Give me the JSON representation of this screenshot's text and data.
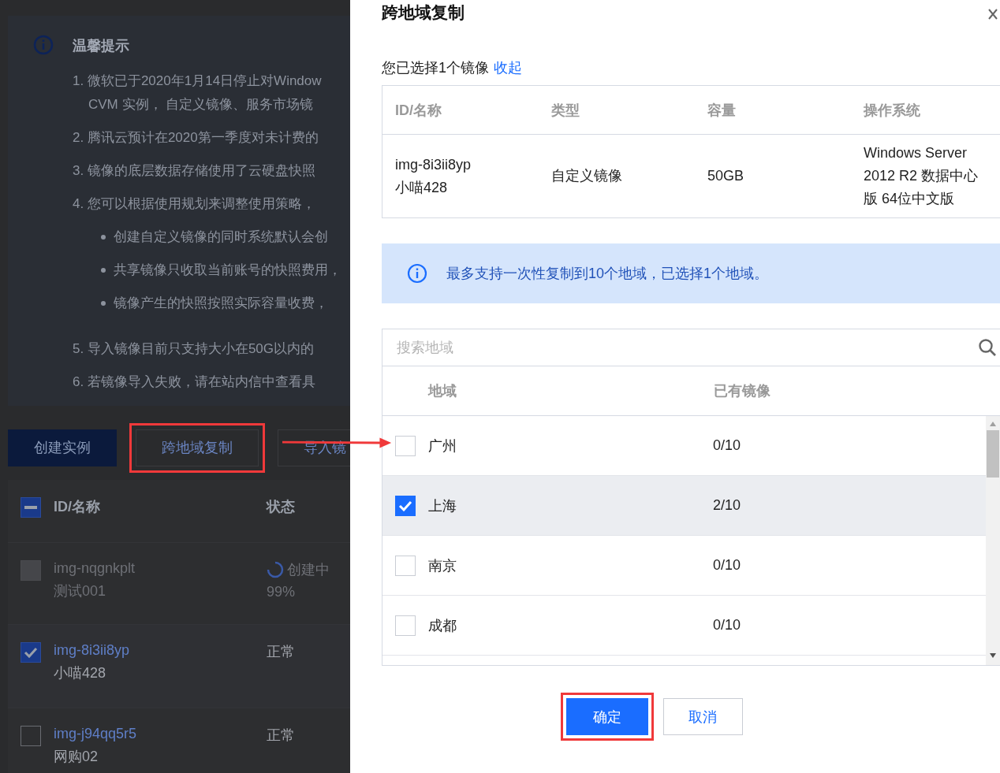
{
  "notice": {
    "title": "温馨提示",
    "items": [
      {
        "kind": "numbered",
        "lines": [
          "1. 微软已于2020年1月14日停止对Window",
          "CVM 实例， 自定义镜像、服务市场镜"
        ]
      },
      {
        "kind": "numbered",
        "lines": [
          "2. 腾讯云预计在2020第一季度对未计费的"
        ]
      },
      {
        "kind": "numbered",
        "lines": [
          "3. 镜像的底层数据存储使用了云硬盘快照"
        ]
      },
      {
        "kind": "numbered",
        "lines": [
          "4. 您可以根据使用规划来调整使用策略，"
        ]
      },
      {
        "kind": "bullet",
        "lines": [
          "创建自定义镜像的同时系统默认会创"
        ]
      },
      {
        "kind": "bullet",
        "lines": [
          "共享镜像只收取当前账号的快照费用，"
        ]
      },
      {
        "kind": "bullet",
        "lines": [
          "镜像产生的快照按照实际容量收费，"
        ]
      },
      {
        "kind": "numbered",
        "lines": [
          "5. 导入镜像目前只支持大小在50G以内的"
        ]
      },
      {
        "kind": "numbered",
        "lines": [
          "6. 若镜像导入失败，请在站内信中查看具"
        ]
      }
    ]
  },
  "toolbar": [
    {
      "label": "创建实例",
      "kind": "primary",
      "highlighted": false
    },
    {
      "label": "跨地域复制",
      "kind": "default",
      "highlighted": true
    },
    {
      "label": "导入镜",
      "kind": "default",
      "highlighted": false
    }
  ],
  "image_list": {
    "select_all_checked": true,
    "select_all_indeterminate": true,
    "columns": [
      "ID/名称",
      "状态"
    ],
    "rows": [
      {
        "id": "img-nqgnkplt",
        "name": "测试001",
        "status": "创建中",
        "progress": "99%",
        "kind": "creating",
        "checked": false,
        "disabled": true
      },
      {
        "id": "img-8i3ii8yp",
        "name": "小喵428",
        "status": "正常",
        "kind": "normal",
        "checked": true,
        "disabled": false
      },
      {
        "id": "img-j94qq5r5",
        "name": "网购02",
        "status": "正常",
        "kind": "normal",
        "checked": false,
        "disabled": false
      }
    ]
  },
  "drawer": {
    "title": "跨地域复制",
    "selected_note": "您已选择1个镜像",
    "collapse_link": "收起",
    "image_table": {
      "columns": [
        "ID/名称",
        "类型",
        "容量",
        "操作系统"
      ],
      "rows": [
        {
          "id": "img-8i3ii8yp",
          "name": "小喵428",
          "type": "自定义镜像",
          "size": "50GB",
          "os": "Windows Server 2012 R2 数据中心版 64位中文版"
        }
      ]
    },
    "info": "最多支持一次性复制到10个地域，已选择1个地域。",
    "search": {
      "placeholder": "搜索地域"
    },
    "region_table": {
      "columns": [
        "地域",
        "已有镜像"
      ],
      "rows": [
        {
          "region": "广州",
          "count": "0/10",
          "checked": false
        },
        {
          "region": "上海",
          "count": "2/10",
          "checked": true
        },
        {
          "region": "南京",
          "count": "0/10",
          "checked": false
        },
        {
          "region": "成都",
          "count": "0/10",
          "checked": false
        }
      ]
    },
    "buttons": [
      {
        "label": "确定",
        "kind": "primary",
        "highlighted": true
      },
      {
        "label": "取消",
        "kind": "default",
        "highlighted": false
      }
    ]
  }
}
